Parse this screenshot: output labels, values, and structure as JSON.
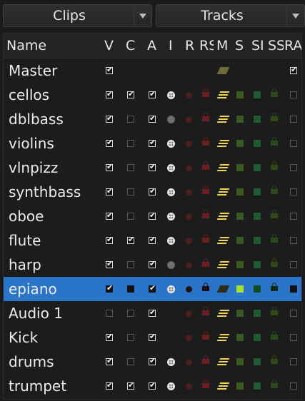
{
  "dropdowns": [
    {
      "label": "Clips"
    },
    {
      "label": "Tracks"
    }
  ],
  "columns": [
    "Name",
    "V",
    "C",
    "A",
    "I",
    "R",
    "RS",
    "M",
    "S",
    "SI",
    "SS",
    "RA"
  ],
  "rows": [
    {
      "name": "Master",
      "v": true,
      "c": null,
      "a": null,
      "i": null,
      "r": null,
      "rs": null,
      "m": "dim",
      "s": null,
      "si": null,
      "ss": null,
      "ra": true,
      "selected": false
    },
    {
      "name": "cellos",
      "v": true,
      "c": true,
      "a": true,
      "i": "on",
      "r": true,
      "rs": true,
      "m": "on",
      "s": true,
      "si": true,
      "ss": true,
      "ra": false,
      "selected": false
    },
    {
      "name": "dblbass",
      "v": true,
      "c": false,
      "a": true,
      "i": "dim",
      "r": true,
      "rs": true,
      "m": "on",
      "s": true,
      "si": true,
      "ss": true,
      "ra": false,
      "selected": false
    },
    {
      "name": "violins",
      "v": true,
      "c": false,
      "a": true,
      "i": "on",
      "r": true,
      "rs": true,
      "m": "on",
      "s": true,
      "si": true,
      "ss": true,
      "ra": false,
      "selected": false
    },
    {
      "name": "vlnpizz",
      "v": true,
      "c": false,
      "a": true,
      "i": "on",
      "r": true,
      "rs": true,
      "m": "on",
      "s": true,
      "si": true,
      "ss": true,
      "ra": false,
      "selected": false
    },
    {
      "name": "synthbass",
      "v": true,
      "c": false,
      "a": true,
      "i": "on",
      "r": true,
      "rs": true,
      "m": "on",
      "s": true,
      "si": true,
      "ss": true,
      "ra": false,
      "selected": false
    },
    {
      "name": "oboe",
      "v": true,
      "c": false,
      "a": true,
      "i": "on",
      "r": true,
      "rs": true,
      "m": "on",
      "s": true,
      "si": true,
      "ss": true,
      "ra": false,
      "selected": false
    },
    {
      "name": "flute",
      "v": true,
      "c": true,
      "a": true,
      "i": "on",
      "r": true,
      "rs": true,
      "m": "on",
      "s": true,
      "si": true,
      "ss": true,
      "ra": false,
      "selected": false
    },
    {
      "name": "harp",
      "v": true,
      "c": false,
      "a": true,
      "i": "dim",
      "r": true,
      "rs": true,
      "m": "on",
      "s": true,
      "si": true,
      "ss": true,
      "ra": false,
      "selected": false
    },
    {
      "name": "epiano",
      "v": true,
      "c": false,
      "a": true,
      "i": "on",
      "r": true,
      "rs": true,
      "m": "on",
      "s": true,
      "si": true,
      "ss": true,
      "ra": false,
      "selected": true
    },
    {
      "name": "Audio 1",
      "v": false,
      "c": false,
      "a": true,
      "i": null,
      "r": true,
      "rs": true,
      "m": "on",
      "s": true,
      "si": true,
      "ss": true,
      "ra": false,
      "selected": false
    },
    {
      "name": "Kick",
      "v": true,
      "c": false,
      "a": true,
      "i": null,
      "r": true,
      "rs": true,
      "m": "on",
      "s": true,
      "si": true,
      "ss": true,
      "ra": false,
      "selected": false
    },
    {
      "name": "drums",
      "v": true,
      "c": false,
      "a": true,
      "i": "on",
      "r": true,
      "rs": true,
      "m": "on",
      "s": true,
      "si": true,
      "ss": true,
      "ra": false,
      "selected": false
    },
    {
      "name": "trumpet",
      "v": true,
      "c": true,
      "a": true,
      "i": "on",
      "r": true,
      "rs": true,
      "m": "on",
      "s": true,
      "si": true,
      "ss": true,
      "ra": false,
      "selected": false
    }
  ],
  "colors": {
    "selection": "#2b75c9",
    "record": "#4a1f1f",
    "lock": "#6c1e1e",
    "midi": "#eed65e",
    "solo": "#385a21",
    "solo_iso": "#1f5a33"
  }
}
